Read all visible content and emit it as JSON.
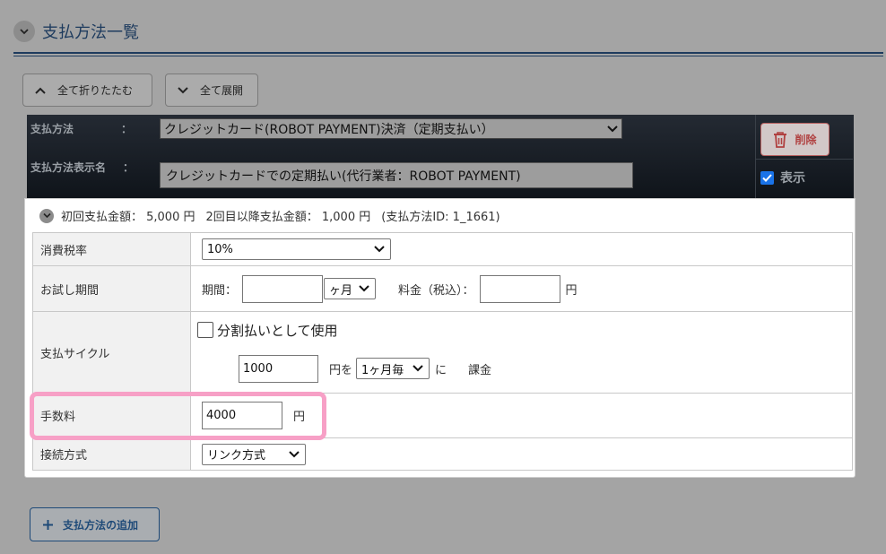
{
  "section": {
    "title": "支払方法一覧"
  },
  "toolbar": {
    "collapse_all": "全て折りたたむ",
    "expand_all": "全て展開"
  },
  "payment_method": {
    "method_label": "支払方法",
    "colon": "：",
    "method_value": "クレジットカード(ROBOT PAYMENT)決済（定期支払い）",
    "display_name_label": "支払方法表示名",
    "display_name_value": "クレジットカードでの定期払い(代行業者：ROBOT PAYMENT)",
    "delete_label": "削除",
    "show_label": "表示",
    "summary": {
      "first_amount": "初回支払金額： 5,000 円",
      "second_amount": "2回目以降支払金額： 1,000 円",
      "method_id": "(支払方法ID: 1_1661)"
    },
    "rows": {
      "tax": {
        "label": "消費税率",
        "value": "10%"
      },
      "trial": {
        "label": "お試し期間",
        "period_label": "期間：",
        "period_value": "",
        "period_unit": "ヶ月",
        "fee_label": "料金（税込）：",
        "fee_value": "",
        "yen": "円"
      },
      "cycle": {
        "label": "支払サイクル",
        "installment_label": "分割払いとして使用",
        "amount_value": "1000",
        "yen_wo": "円を",
        "interval": "1ヶ月毎",
        "ni": "に",
        "charge": "課金"
      },
      "fee": {
        "label": "手数料",
        "value": "4000",
        "yen": "円"
      },
      "connection": {
        "label": "接続方式",
        "value": "リンク方式"
      }
    }
  },
  "add_button": {
    "label": "支払方法の追加"
  },
  "colors": {
    "accent": "#1e3b5e",
    "highlight": "#f7a0c6",
    "delete": "#b04040",
    "check": "#1a73e8"
  }
}
